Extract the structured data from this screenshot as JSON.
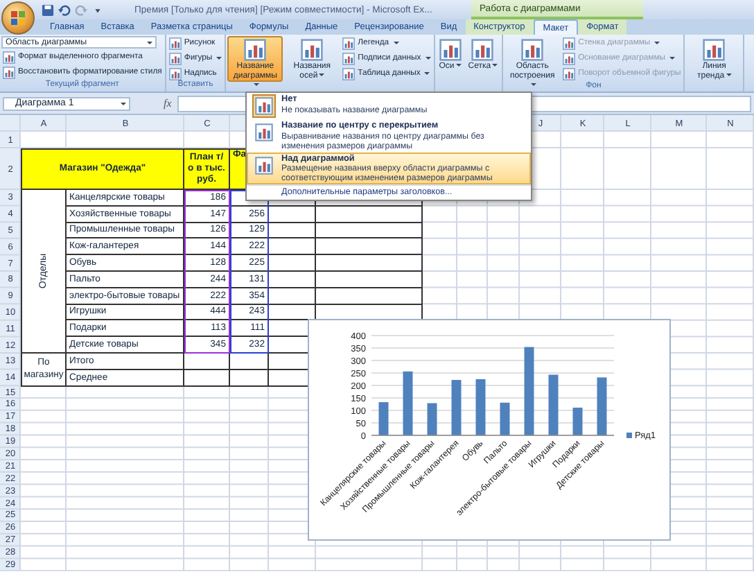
{
  "window": {
    "title": "Премия  [Только для чтения]  [Режим совместимости] - Microsoft Ex...",
    "context_title": "Работа с диаграммами"
  },
  "tabs": [
    {
      "label": "Главная",
      "selected": false,
      "contextual": false
    },
    {
      "label": "Вставка",
      "selected": false,
      "contextual": false
    },
    {
      "label": "Разметка страницы",
      "selected": false,
      "contextual": false
    },
    {
      "label": "Формулы",
      "selected": false,
      "contextual": false
    },
    {
      "label": "Данные",
      "selected": false,
      "contextual": false
    },
    {
      "label": "Рецензирование",
      "selected": false,
      "contextual": false
    },
    {
      "label": "Вид",
      "selected": false,
      "contextual": false
    },
    {
      "label": "Конструктор",
      "selected": false,
      "contextual": true
    },
    {
      "label": "Макет",
      "selected": true,
      "contextual": true
    },
    {
      "label": "Формат",
      "selected": false,
      "contextual": true
    }
  ],
  "ribbon": {
    "groups": [
      {
        "label": "Текущий фрагмент",
        "selector": "Область диаграммы",
        "small": [
          {
            "label": "Формат выделенного фрагмента",
            "dropdown": false,
            "disabled": false
          },
          {
            "label": "Восстановить форматирование стиля",
            "dropdown": false,
            "disabled": false
          }
        ]
      },
      {
        "label": "Вставить",
        "small": [
          {
            "label": "Рисунок",
            "dropdown": false,
            "disabled": false
          },
          {
            "label": "Фигуры",
            "dropdown": true,
            "disabled": false
          },
          {
            "label": "Надпись",
            "dropdown": false,
            "disabled": false
          }
        ]
      },
      {
        "big": [
          {
            "label": "Название диаграммы",
            "dropdown": true,
            "pressed": true
          },
          {
            "label": "Названия осей",
            "dropdown": true,
            "pressed": false
          }
        ],
        "small": [
          {
            "label": "Легенда",
            "dropdown": true,
            "disabled": false
          },
          {
            "label": "Подписи данных",
            "dropdown": true,
            "disabled": false
          },
          {
            "label": "Таблица данных",
            "dropdown": true,
            "disabled": false
          }
        ]
      },
      {
        "big": [
          {
            "label": "Оси",
            "dropdown": true,
            "pressed": false
          },
          {
            "label": "Сетка",
            "dropdown": true,
            "pressed": false
          }
        ]
      },
      {
        "label": "Фон",
        "big": [
          {
            "label": "Область построения",
            "dropdown": true,
            "pressed": false
          }
        ],
        "small": [
          {
            "label": "Стенка диаграммы",
            "dropdown": true,
            "disabled": true
          },
          {
            "label": "Основание диаграммы",
            "dropdown": true,
            "disabled": true
          },
          {
            "label": "Поворот объемной фигуры",
            "dropdown": false,
            "disabled": true
          }
        ]
      },
      {
        "big": [
          {
            "label": "Линия тренда",
            "dropdown": true,
            "pressed": false
          }
        ]
      }
    ]
  },
  "formula_bar": {
    "name_box": "Диаграмма 1",
    "function_label": "fx"
  },
  "sheet": {
    "column_headers": [
      "A",
      "B",
      "C",
      "J",
      "K",
      "L",
      "M",
      "N"
    ],
    "row_numbers": [
      "1",
      "2",
      "3",
      "4",
      "5",
      "6",
      "7",
      "8",
      "9",
      "10",
      "11",
      "12",
      "13",
      "14",
      "15",
      "16",
      "17",
      "18",
      "19",
      "20",
      "21",
      "22",
      "23",
      "24",
      "25",
      "26",
      "27",
      "28",
      "29"
    ],
    "title_cell": "Магазин \"Одежда\"",
    "plan_header": "План т/о в тыс. руб.",
    "fact_header": "Фа",
    "group_label": "Отделы",
    "rows": [
      {
        "name": "Канцелярские товары",
        "plan": "186"
      },
      {
        "name": "Хозяйственные товары",
        "plan": "147",
        "fact": "256"
      },
      {
        "name": "Промышленные товары",
        "plan": "126",
        "fact": "129"
      },
      {
        "name": "Кож-галантерея",
        "plan": "144",
        "fact": "222"
      },
      {
        "name": "Обувь",
        "plan": "128",
        "fact": "225"
      },
      {
        "name": "Пальто",
        "plan": "244",
        "fact": "131"
      },
      {
        "name": "электро-бытовые товары",
        "plan": "222",
        "fact": "354"
      },
      {
        "name": "Игрушки",
        "plan": "444",
        "fact": "243"
      },
      {
        "name": "Подарки",
        "plan": "113",
        "fact": "111"
      },
      {
        "name": "Детские товары",
        "plan": "345",
        "fact": "232"
      }
    ],
    "summary_label": "По магазину",
    "summary_rows": [
      "Итого",
      "Среднее"
    ]
  },
  "title_menu": {
    "items": [
      {
        "title": "Нет",
        "description": "Не показывать название диаграммы",
        "selected": false,
        "current": true
      },
      {
        "title": "Название по центру с перекрытием",
        "description": "Выравнивание названия по центру диаграммы без изменения размеров диаграммы",
        "selected": false,
        "current": false
      },
      {
        "title": "Над диаграммой",
        "description": "Размещение названия вверху области диаграммы с соответствующим изменением размеров диаграммы",
        "selected": true,
        "current": false
      }
    ],
    "more": "Дополнительные параметры заголовков..."
  },
  "chart": {
    "chart_data": {
      "type": "bar",
      "categories": [
        "Канцелярские товары",
        "Хозяйственные товары",
        "Промышленные товары",
        "Кож-галантерея",
        "Обувь",
        "Пальто",
        "электро-бытовые товары",
        "Игрушки",
        "Подарки",
        "Детские товары"
      ],
      "series": [
        {
          "name": "Ряд1",
          "color": "#4f81bd",
          "values": [
            133,
            256,
            129,
            222,
            225,
            131,
            354,
            243,
            111,
            232
          ]
        }
      ],
      "grid": true,
      "ylim": [
        0,
        400
      ],
      "yticks": [
        0,
        50,
        100,
        150,
        200,
        250,
        300,
        350,
        400
      ]
    }
  }
}
